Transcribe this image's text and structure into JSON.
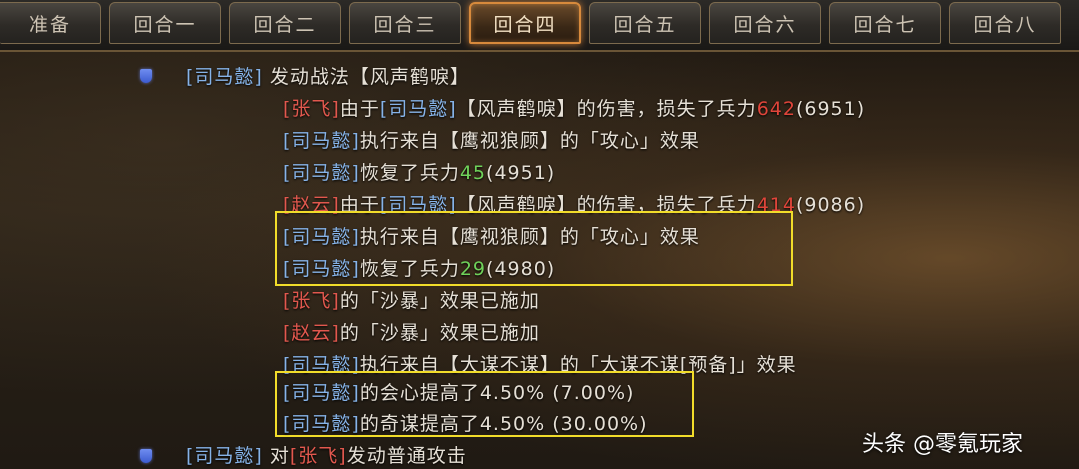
{
  "tabs": [
    {
      "label": "准备"
    },
    {
      "label": "回合一"
    },
    {
      "label": "回合二"
    },
    {
      "label": "回合三"
    },
    {
      "label": "回合四"
    },
    {
      "label": "回合五"
    },
    {
      "label": "回合六"
    },
    {
      "label": "回合七"
    },
    {
      "label": "回合八"
    }
  ],
  "active_tab": "回合四",
  "icons": {
    "bullet": "shield-icon"
  },
  "colors": {
    "hero_ally": "#86b3e8",
    "hero_enemy": "#e2584e",
    "damage": "#e0453a",
    "heal": "#6fd25a",
    "highlight": "#f1dc2a"
  },
  "log": {
    "l1": {
      "hero": "[司马懿]",
      "text": " 发动战法【风声鹤唳】"
    },
    "l2": {
      "hero": "[张飞]",
      "mid1": "由于",
      "hero2": "[司马懿]",
      "mid2": "【风声鹤唳】的伤害，损失了兵力",
      "value": "642",
      "rest": "(6951)"
    },
    "l3": {
      "hero": "[司马懿]",
      "text": "执行来自【鹰视狼顾】的「攻心」效果"
    },
    "l4": {
      "hero": "[司马懿]",
      "mid": "恢复了兵力",
      "value": "45",
      "rest": "(4951)"
    },
    "l5": {
      "hero": "[赵云]",
      "mid1": "由于",
      "hero2": "[司马懿]",
      "mid2": "【风声鹤唳】的伤害，损失了兵力",
      "value": "414",
      "rest": "(9086)"
    },
    "l6": {
      "hero": "[司马懿]",
      "text": "执行来自【鹰视狼顾】的「攻心」效果"
    },
    "l7": {
      "hero": "[司马懿]",
      "mid": "恢复了兵力",
      "value": "29",
      "rest": "(4980)"
    },
    "l8": {
      "hero": "[张飞]",
      "text": "的「沙暴」效果已施加"
    },
    "l9": {
      "hero": "[赵云]",
      "text": "的「沙暴」效果已施加"
    },
    "l10": {
      "hero": "[司马懿]",
      "text": "执行来自【大谋不谋】的「大谋不谋[预备]」效果"
    },
    "l11": {
      "hero": "[司马懿]",
      "text": "的会心提高了4.50% (7.00%)"
    },
    "l12": {
      "hero": "[司马懿]",
      "text": "的奇谋提高了4.50% (30.00%)"
    },
    "l13": {
      "hero": "[司马懿]",
      "mid": " 对",
      "hero2": "[张飞]",
      "text": "发动普通攻击"
    }
  },
  "watermark": "头条 @零氪玩家"
}
